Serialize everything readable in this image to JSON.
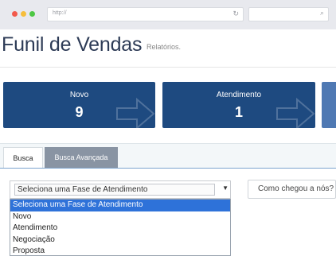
{
  "browser": {
    "url": "http://",
    "reload_icon": "reload-icon",
    "search_icon": "search-icon"
  },
  "header": {
    "title": "Funil de Vendas",
    "subtitle": "Relatórios."
  },
  "cards": [
    {
      "label": "Novo",
      "count": "9"
    },
    {
      "label": "Atendimento",
      "count": "1"
    }
  ],
  "tabs": [
    {
      "label": "Busca",
      "active": true
    },
    {
      "label": "Busca Avançada",
      "active": false
    }
  ],
  "filter": {
    "selected": "Seleciona uma Fase de Atendimento",
    "options": [
      "Seleciona uma Fase de Atendimento",
      "Novo",
      "Atendimento",
      "Negociação",
      "Proposta"
    ],
    "como_chegou": "Como chegou a nós?"
  },
  "colors": {
    "card": "#1e4a80",
    "selected_option": "#2e72d9",
    "tab_inactive": "#8994a3"
  }
}
